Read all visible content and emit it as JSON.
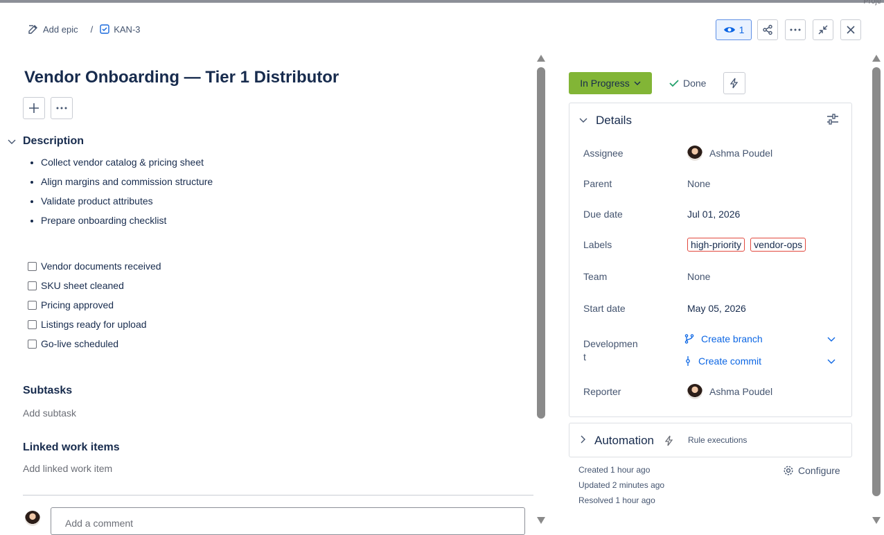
{
  "top_fragment": "Proje",
  "breadcrumbs": {
    "add_epic": "Add epic",
    "separator": "/",
    "issue_key": "KAN-3"
  },
  "toolbar": {
    "watch_count": "1"
  },
  "issue": {
    "title": "Vendor Onboarding — Tier 1 Distributor"
  },
  "description": {
    "heading": "Description",
    "bullets": [
      "Collect vendor catalog & pricing sheet",
      "Align margins and commission structure",
      "Validate product attributes",
      "Prepare onboarding checklist"
    ],
    "checklist": [
      "Vendor documents received",
      "SKU sheet cleaned",
      "Pricing approved",
      "Listings ready for upload",
      "Go-live scheduled"
    ]
  },
  "subtasks": {
    "heading": "Subtasks",
    "add": "Add subtask"
  },
  "linked": {
    "heading": "Linked work items",
    "add": "Add linked work item"
  },
  "comment": {
    "placeholder": "Add a comment"
  },
  "status": {
    "current": "In Progress",
    "done": "Done"
  },
  "details": {
    "heading": "Details",
    "assignee": {
      "label": "Assignee",
      "value": "Ashma Poudel"
    },
    "parent": {
      "label": "Parent",
      "value": "None"
    },
    "due": {
      "label": "Due date",
      "value": "Jul 01, 2026"
    },
    "labels": {
      "label": "Labels",
      "values": [
        "high-priority",
        "vendor-ops"
      ]
    },
    "team": {
      "label": "Team",
      "value": "None"
    },
    "start": {
      "label": "Start date",
      "value": "May 05, 2026"
    },
    "development": {
      "label_1": "Developmen",
      "label_2": "t",
      "branch": "Create branch",
      "commit": "Create commit"
    },
    "reporter": {
      "label": "Reporter",
      "value": "Ashma Poudel"
    }
  },
  "automation": {
    "heading": "Automation",
    "rule": "Rule executions"
  },
  "meta": {
    "created": "Created 1 hour ago",
    "updated": "Updated 2 minutes ago",
    "resolved": "Resolved 1 hour ago",
    "configure": "Configure"
  },
  "colors": {
    "accent": "#0c66e4",
    "status_green": "#82b536",
    "label_border": "#e2483d"
  }
}
